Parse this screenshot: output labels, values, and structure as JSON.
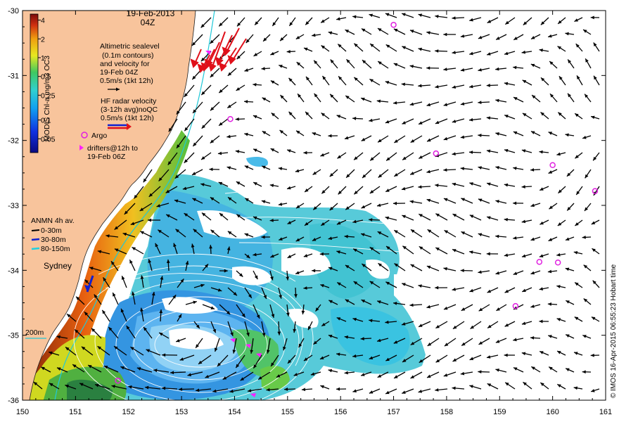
{
  "header": {
    "date": "19-Feb-2013",
    "time": "04Z"
  },
  "axes": {
    "lon_ticks": [
      "150",
      "151",
      "152",
      "153",
      "154",
      "155",
      "156",
      "157",
      "158",
      "159",
      "160",
      "161"
    ],
    "lat_ticks": [
      "-30",
      "-31",
      "-32",
      "-33",
      "-34",
      "-35",
      "-36"
    ],
    "lon_range": [
      150,
      161
    ],
    "lat_range": [
      -36,
      -30
    ]
  },
  "colorbar": {
    "label": "MODIS Chl-a mg/m3 OC3",
    "ticks": [
      "4",
      "2",
      "1",
      "0.5",
      "0.25",
      "0.1",
      "0.05"
    ],
    "tick_values": [
      4,
      2,
      1,
      0.5,
      0.25,
      0.1,
      0.05
    ],
    "range": [
      0.03,
      5
    ],
    "scale": "log"
  },
  "legend": {
    "altimetry": [
      "Altimetric sealevel",
      "(0.1m contours)",
      "and velocity for",
      "19-Feb 04Z",
      "0.5m/s (1kt 12h)"
    ],
    "hf_radar": [
      "HF radar velocity",
      "(3-12h avg)noQC",
      "0.5m/s (1kt 12h)"
    ],
    "argo": "Argo",
    "drifters": [
      "drifters@12h to",
      "19-Feb 06Z"
    ],
    "anmn_title": "ANMN 4h av.",
    "anmn_items": [
      "0-30m",
      "30-80m",
      "80-150m"
    ]
  },
  "places": {
    "sydney": "Sydney",
    "isobath": "200m"
  },
  "credit": "© IMOS 16-Apr-2015 06:55:23 Hobart time",
  "argo_floats": [
    {
      "lon": 157.0,
      "lat": -30.22
    },
    {
      "lon": 153.92,
      "lat": -31.67
    },
    {
      "lon": 157.8,
      "lat": -32.2
    },
    {
      "lon": 160.0,
      "lat": -32.38
    },
    {
      "lon": 160.8,
      "lat": -32.78
    },
    {
      "lon": 159.75,
      "lat": -33.87
    },
    {
      "lon": 160.1,
      "lat": -33.88
    },
    {
      "lon": 159.3,
      "lat": -34.55
    },
    {
      "lon": 151.8,
      "lat": -35.7
    }
  ],
  "colors": {
    "land": "#f8c49c",
    "hf_radar": "#e0101a",
    "drifter": "#ff20ff",
    "argo": "#e020e0",
    "anmn_30_80": "#1020d0",
    "anmn_80_150": "#20d0e0"
  }
}
